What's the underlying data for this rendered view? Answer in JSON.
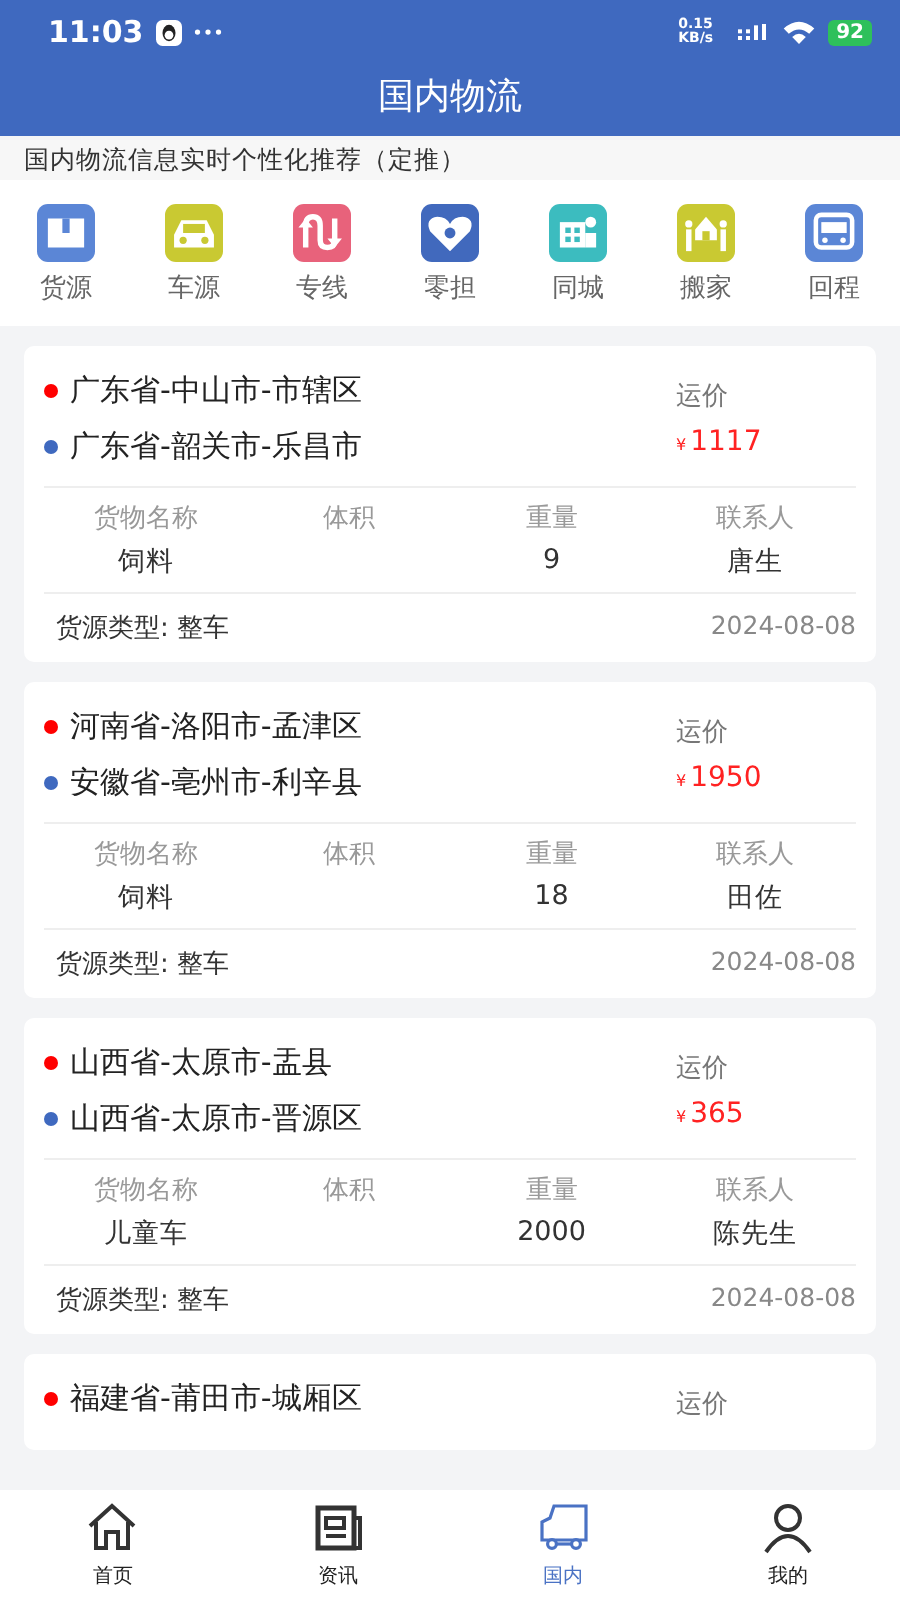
{
  "status_bar": {
    "time": "11:03",
    "net_speed": "0.15 KB/s",
    "battery": "92"
  },
  "header": {
    "title": "国内物流"
  },
  "notice": "国内物流信息实时个性化推荐（定推）",
  "categories": [
    {
      "label": "货源",
      "kind": "box",
      "color": "#5b86d6"
    },
    {
      "label": "车源",
      "kind": "car",
      "color": "#c9c932"
    },
    {
      "label": "专线",
      "kind": "route",
      "color": "#e8627b"
    },
    {
      "label": "零担",
      "kind": "heart",
      "color": "#4169bd"
    },
    {
      "label": "同城",
      "kind": "city",
      "color": "#3cbcbf"
    },
    {
      "label": "搬家",
      "kind": "house",
      "color": "#c9c932"
    },
    {
      "label": "回程",
      "kind": "truck",
      "color": "#5b86d6"
    }
  ],
  "cards": [
    {
      "origin": "广东省-中山市-市辖区",
      "destination": "广东省-韶关市-乐昌市",
      "price_label": "运价",
      "currency": "¥",
      "price": "1117",
      "cells": [
        {
          "header": "货物名称",
          "value": "饲料"
        },
        {
          "header": "体积"
        },
        {
          "header": "重量",
          "value": "9"
        },
        {
          "header": "联系人",
          "value": "唐生"
        }
      ],
      "type": "货源类型: 整车",
      "date": "2024-08-08"
    },
    {
      "origin": "河南省-洛阳市-孟津区",
      "destination": "安徽省-亳州市-利辛县",
      "price_label": "运价",
      "currency": "¥",
      "price": "1950",
      "cells": [
        {
          "header": "货物名称",
          "value": "饲料"
        },
        {
          "header": "体积"
        },
        {
          "header": "重量",
          "value": "18"
        },
        {
          "header": "联系人",
          "value": "田佐"
        }
      ],
      "type": "货源类型: 整车",
      "date": "2024-08-08"
    },
    {
      "origin": "山西省-太原市-盂县",
      "destination": "山西省-太原市-晋源区",
      "price_label": "运价",
      "currency": "¥",
      "price": "365",
      "cells": [
        {
          "header": "货物名称",
          "value": "儿童车"
        },
        {
          "header": "体积"
        },
        {
          "header": "重量",
          "value": "2000"
        },
        {
          "header": "联系人",
          "value": "陈先生"
        }
      ],
      "type": "货源类型: 整车",
      "date": "2024-08-08"
    },
    {
      "origin": "福建省-莆田市-城厢区",
      "price_label": "运价"
    }
  ],
  "bottom_nav": [
    {
      "label": "首页",
      "kind": "home",
      "selected": false
    },
    {
      "label": "资讯",
      "kind": "news",
      "selected": false
    },
    {
      "label": "国内",
      "kind": "truck",
      "selected": true
    },
    {
      "label": "我的",
      "kind": "user",
      "selected": false
    }
  ]
}
